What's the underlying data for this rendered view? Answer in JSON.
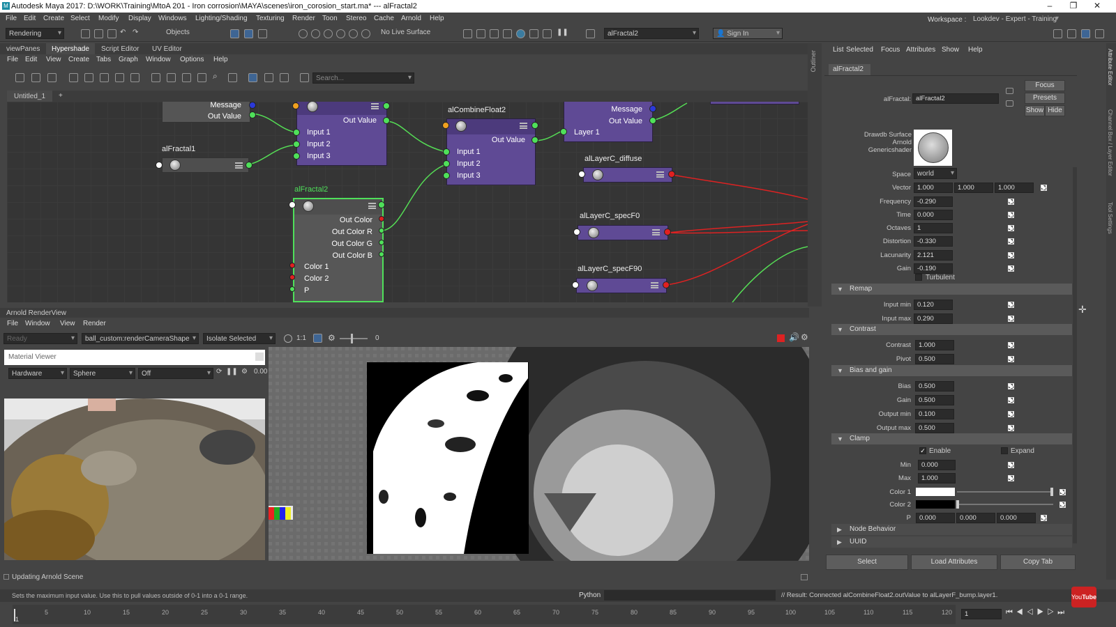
{
  "titlebar": {
    "title": "Autodesk Maya 2017: D:\\WORK\\Training\\MtoA 201 - Iron corrosion\\MAYA\\scenes\\iron_corosion_start.ma*   ---   alFractal2"
  },
  "main_menu": [
    "File",
    "Edit",
    "Create",
    "Select",
    "Modify",
    "Display",
    "Windows",
    "Lighting/Shading",
    "Texturing",
    "Render",
    "Toon",
    "Stereo",
    "Cache",
    "Arnold",
    "Help"
  ],
  "shelf": {
    "mode": "Rendering",
    "objects": "Objects",
    "live_surface": "No Live Surface",
    "node_field": "alFractal2",
    "sign_in": "Sign In",
    "workspace_label": "Workspace :",
    "workspace_value": "Lookdev - Expert - Training"
  },
  "panel_tabs": [
    "viewPanes",
    "Hypershade",
    "Script Editor",
    "UV Editor"
  ],
  "hypershade_menu": [
    "File",
    "Edit",
    "View",
    "Create",
    "Tabs",
    "Graph",
    "Window",
    "Options",
    "Help"
  ],
  "search_placeholder": "Search...",
  "graph_tab": "Untitled_1",
  "graph_tab_add": "+",
  "outliner_label": "Outliner",
  "nodes": {
    "top_left": {
      "p1": "Message",
      "p2": "Out Value"
    },
    "alFractal1": {
      "name": "alFractal1"
    },
    "combine_left": {
      "out": "Out Value",
      "in1": "Input 1",
      "in2": "Input 2",
      "in3": "Input 3"
    },
    "alFractal2": {
      "name": "alFractal2",
      "out_color": "Out Color",
      "r": "Out Color R",
      "g": "Out Color G",
      "b": "Out Color B",
      "c1": "Color 1",
      "c2": "Color 2",
      "p": "P"
    },
    "alCombineFloat2": {
      "name": "alCombineFloat2",
      "out": "Out Value",
      "in1": "Input 1",
      "in2": "Input 2",
      "in3": "Input 3"
    },
    "layer": {
      "message": "Message",
      "out": "Out Value",
      "layer1": "Layer 1"
    },
    "alLayerC_diffuse": {
      "name": "alLayerC_diffuse"
    },
    "alLayerC_specF0": {
      "name": "alLayerC_specF0"
    },
    "alLayerC_specF90": {
      "name": "alLayerC_specF90"
    }
  },
  "renderview": {
    "title": "Arnold RenderView",
    "menu": [
      "File",
      "Window",
      "View",
      "Render"
    ],
    "state": "Ready",
    "camera": "ball_custom:renderCameraShape",
    "isolate": "Isolate Selected",
    "ratio": "1:1",
    "exposure": "0"
  },
  "material_viewer": {
    "title": "Material Viewer",
    "renderer": "Hardware",
    "shape": "Sphere",
    "bg": "Off",
    "value": "0.00"
  },
  "status_line": {
    "left": "Updating Arnold Scene"
  },
  "attr_editor": {
    "menu": [
      "List",
      "Selected",
      "Focus",
      "Attributes",
      "Show",
      "Help"
    ],
    "tab": "alFractal2",
    "type_label": "alFractal:",
    "type_value": "alFractal2",
    "focus": "Focus",
    "presets": "Presets",
    "show": "Show",
    "hide": "Hide",
    "shader_desc": "Drawdb Surface Arnold Genericshader",
    "space_label": "Space",
    "space_value": "world",
    "vector_label": "Vector",
    "vector": [
      "1.000",
      "1.000",
      "1.000"
    ],
    "fields": [
      {
        "label": "Frequency",
        "value": "-0.290"
      },
      {
        "label": "Time",
        "value": "0.000"
      },
      {
        "label": "Octaves",
        "value": "1"
      },
      {
        "label": "Distortion",
        "value": "-0.330"
      },
      {
        "label": "Lacunarity",
        "value": "2.121"
      },
      {
        "label": "Gain",
        "value": "-0.190"
      }
    ],
    "turbulent": "Turbulent",
    "remap": {
      "title": "Remap",
      "min_label": "Input min",
      "min": "0.120",
      "max_label": "Input max",
      "max": "0.290"
    },
    "contrast": {
      "title": "Contrast",
      "c_label": "Contrast",
      "c": "1.000",
      "p_label": "Pivot",
      "p": "0.500"
    },
    "bias_gain": {
      "title": "Bias and gain",
      "b_label": "Bias",
      "b": "0.500",
      "g_label": "Gain",
      "g": "0.500",
      "omin_label": "Output min",
      "omin": "0.100",
      "omax_label": "Output max",
      "omax": "0.500"
    },
    "clamp": {
      "title": "Clamp",
      "enable": "Enable",
      "expand": "Expand",
      "min_label": "Min",
      "min": "0.000",
      "max_label": "Max",
      "max": "1.000"
    },
    "color1_label": "Color 1",
    "color2_label": "Color 2",
    "p_label": "P",
    "p": [
      "0.000",
      "0.000",
      "0.000"
    ],
    "node_behavior": "Node Behavior",
    "uuid": "UUID",
    "buttons": {
      "select": "Select",
      "load": "Load Attributes",
      "copy": "Copy Tab"
    },
    "side_tabs": [
      "Attribute Editor",
      "Channel Box / Layer Editor",
      "Tool Settings"
    ]
  },
  "help_line": "Sets the maximum input value. Use this to pull values outside of 0-1 into a 0-1 range.",
  "cmd_lang": "Python",
  "result_line": "// Result: Connected alCombineFloat2.outValue to alLayerF_bump.layer1.",
  "timeline": {
    "ticks": [
      "5",
      "10",
      "15",
      "20",
      "25",
      "30",
      "35",
      "40",
      "45",
      "50",
      "55",
      "60",
      "65",
      "70",
      "75",
      "80",
      "85",
      "90",
      "95",
      "100",
      "105",
      "110",
      "115",
      "120"
    ],
    "start": "1",
    "current": "1"
  },
  "colors": {
    "node": "#5f4a95",
    "connection_green": "#55dd55",
    "connection_red": "#dd2222",
    "selected_outline": "#4fe05a"
  }
}
